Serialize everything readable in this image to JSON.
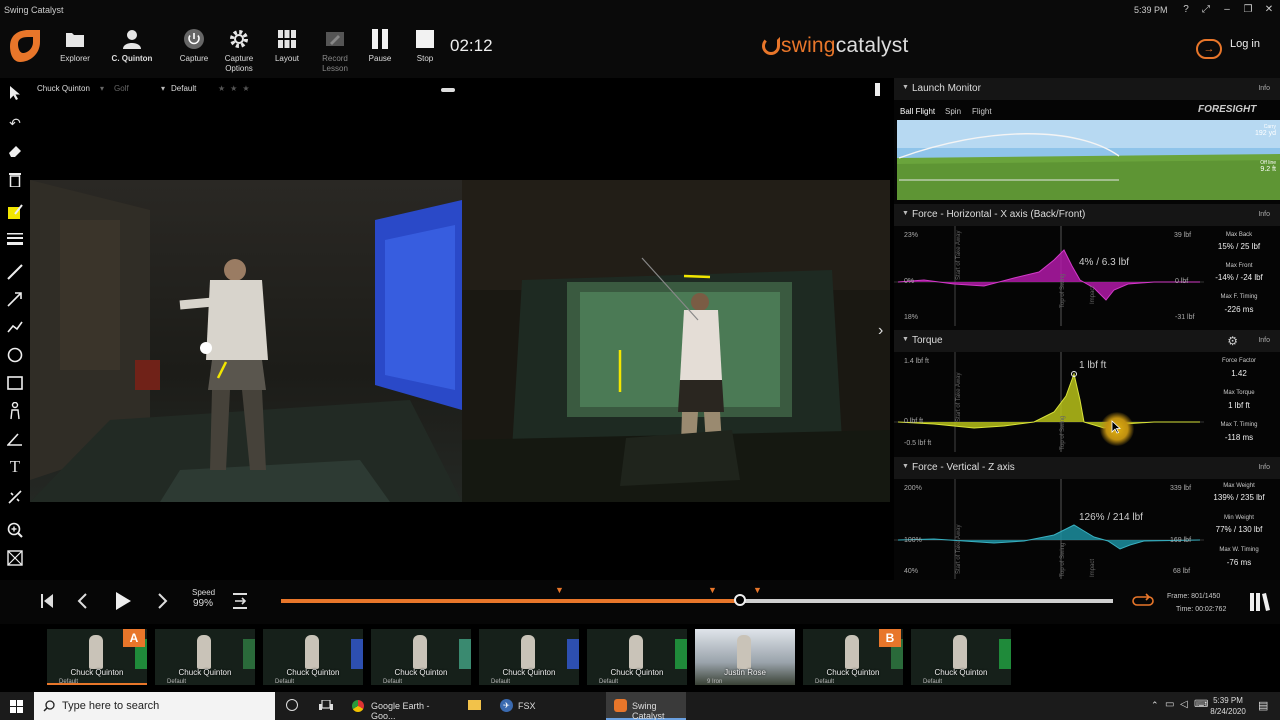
{
  "window": {
    "title": "Swing Catalyst",
    "clock": "5:39 PM"
  },
  "toolbar": {
    "buttons": [
      {
        "icon": "folder-icon",
        "label": "Explorer"
      },
      {
        "icon": "user-icon",
        "label": "C. Quinton"
      },
      {
        "icon": "power-icon",
        "label": "Capture"
      },
      {
        "icon": "gear-icon",
        "label": "Capture\nOptions"
      },
      {
        "icon": "grid-icon",
        "label": "Layout"
      },
      {
        "icon": "record-icon",
        "label": "Record\nLesson"
      },
      {
        "icon": "pause-icon",
        "label": "Pause"
      },
      {
        "icon": "stop-icon",
        "label": "Stop"
      }
    ],
    "timer": "02:12",
    "brand_a": "swing",
    "brand_b": "catalyst",
    "login": "Log in"
  },
  "video_header": {
    "player": "Chuck Quinton",
    "category": "Golf",
    "layout": "Default"
  },
  "launch_monitor": {
    "title": "Launch Monitor",
    "info": "Info",
    "tabs": [
      "Ball Flight",
      "Spin",
      "Flight"
    ],
    "brand": "FORESIGHT",
    "carry_label": "Carry",
    "carry_value": "192 yd",
    "offline_label": "Off line",
    "offline_value": "9.2 ft"
  },
  "force_x": {
    "title": "Force - Horizontal - X axis (Back/Front)",
    "info": "Info",
    "y_top": "23%",
    "y_mid": "0%",
    "y_bot": "18%",
    "r_top": "39 lbf",
    "r_mid": "0 lbf",
    "r_bot": "-31 lbf",
    "peak": "4% / 6.3 lbf",
    "markers": [
      "Start of Take Away",
      "Top of Swing",
      "Impact"
    ],
    "stats": [
      {
        "label": "Max Back",
        "value": "15% / 25 lbf"
      },
      {
        "label": "Max Front",
        "value": "-14% / -24 lbf"
      },
      {
        "label": "Max F. Timing",
        "value": "-226 ms"
      }
    ]
  },
  "torque": {
    "title": "Torque",
    "info": "Info",
    "y_top": "1.4 lbf ft",
    "y_mid": "0 lbf ft",
    "y_bot": "-0.5 lbf ft",
    "peak": "1 lbf ft",
    "stats": [
      {
        "label": "Force Factor",
        "value": "1.42"
      },
      {
        "label": "Max Torque",
        "value": "1 lbf ft"
      },
      {
        "label": "Max T. Timing",
        "value": "-118 ms"
      }
    ]
  },
  "force_z": {
    "title": "Force - Vertical - Z axis",
    "info": "Info",
    "y_top": "200%",
    "y_mid": "100%",
    "y_bot": "40%",
    "r_top": "339 lbf",
    "r_mid": "169 lbf",
    "r_bot": "68 lbf",
    "peak": "126% / 214 lbf",
    "stats": [
      {
        "label": "Max Weight",
        "value": "139% / 235 lbf"
      },
      {
        "label": "Min Weight",
        "value": "77% / 130 lbf"
      },
      {
        "label": "Max W. Timing",
        "value": "-76 ms"
      }
    ]
  },
  "playback": {
    "speed_label": "Speed",
    "speed_value": "99%",
    "progress": 0.552,
    "frame_label": "Frame:",
    "frame_value": "801/1450",
    "time_label": "Time:",
    "time_value": "00:02:762"
  },
  "thumbnails": [
    {
      "name": "Chuck Quinton",
      "sub": "Default",
      "tag": "A",
      "stripe": "#1f8a3a"
    },
    {
      "name": "Chuck Quinton",
      "sub": "Default",
      "tag": "",
      "stripe": "#2a6a3a"
    },
    {
      "name": "Chuck Quinton",
      "sub": "Default",
      "tag": "",
      "stripe": "#2d4fb0"
    },
    {
      "name": "Chuck Quinton",
      "sub": "Default",
      "tag": "",
      "stripe": "#3a8a70"
    },
    {
      "name": "Chuck Quinton",
      "sub": "Default",
      "tag": "",
      "stripe": "#2d4fb0"
    },
    {
      "name": "Chuck Quinton",
      "sub": "Default",
      "tag": "",
      "stripe": "#1f8a3a"
    },
    {
      "name": "Justin Rose",
      "sub": "9 Iron",
      "tag": "",
      "stripe": ""
    },
    {
      "name": "Chuck Quinton",
      "sub": "Default",
      "tag": "B",
      "stripe": "#2a6a3a"
    },
    {
      "name": "Chuck Quinton",
      "sub": "Default",
      "tag": "",
      "stripe": "#1f8a3a"
    }
  ],
  "taskbar": {
    "search_placeholder": "Type here to search",
    "apps": [
      "Google Earth - Goo...",
      "FSX",
      "Swing Catalyst"
    ],
    "time": "5:39 PM",
    "date": "8/24/2020"
  },
  "colors": {
    "accent": "#e8762a",
    "force_x": "#b21aa8",
    "torque": "#b8c21a",
    "force_z": "#1c8fa0"
  }
}
